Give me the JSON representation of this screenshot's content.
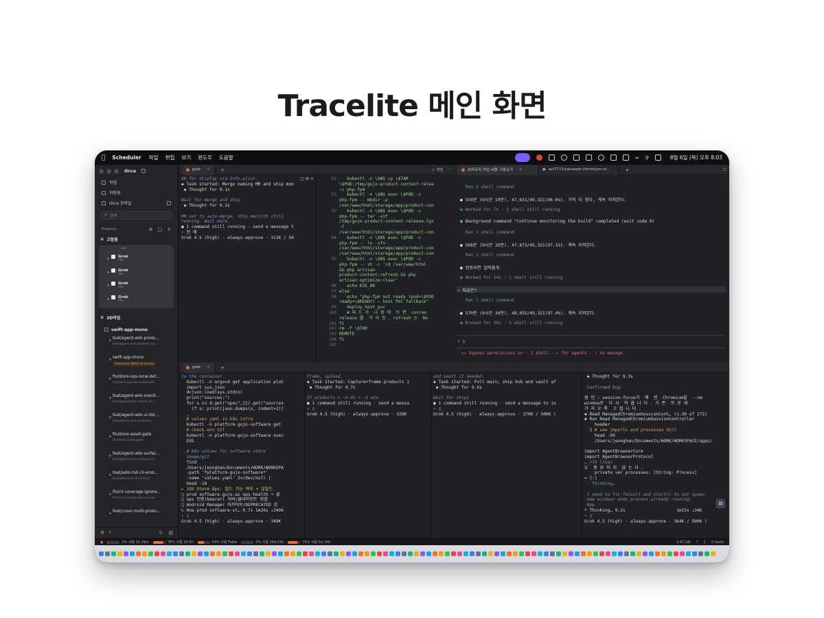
{
  "page_title": "Tracelite 메인 화면",
  "menubar": {
    "app_name": "Scheduler",
    "menus": [
      "파일",
      "편집",
      "보기",
      "윈도우",
      "도움말"
    ],
    "clock": "8월 6일 (목) 오후 8:03"
  },
  "sidebar": {
    "app": "Orca",
    "nav": [
      "작업",
      "자동화",
      "Orca 모바일"
    ],
    "search_placeholder": "검색",
    "projects_label": "Projects",
    "group1": "고정됨",
    "grok_items": [
      {
        "label": "Grok",
        "sub": "Idle"
      },
      {
        "label": "Grok",
        "sub": "Idle"
      },
      {
        "label": "Grok",
        "sub": "Idle"
      },
      {
        "label": "Grok",
        "sub": "Idle"
      }
    ],
    "group2": "3D작업",
    "repo": "swift-app-mono",
    "worktrees": [
      {
        "title": "feat/agent-wiki-produ...",
        "sub": "feat/agent-wiki-product-na..."
      },
      {
        "title": "swift-app-mono",
        "sub": "Detached HEAD @ fcee5b"
      },
      {
        "title": "fix/store-ops-local-def...",
        "sub": "fix/store-ops-local-defaults"
      },
      {
        "title": "feat/agent-wiki-monit...",
        "sub": "feat/agent-wiki-monitr-sh..."
      },
      {
        "title": "feat/agent-wiki-ui-libr...",
        "sub": "feat/agent-wiki-ui-library"
      },
      {
        "title": "fix/store-asset-gate",
        "sub": "fix/store-asset-gate"
      },
      {
        "title": "feat/agent-wiki-surfac...",
        "sub": "feat/agent-wiki-surface-na..."
      },
      {
        "title": "feat/adm-full-cli-emb...",
        "sub": "feat/adm-full-cli-embed"
      },
      {
        "title": "fix/cli-coverage-ignore...",
        "sub": "fix/cli-coverage-ignore-aux"
      },
      {
        "title": "feat/cross-multi-produ...",
        "sub": ""
      }
    ]
  },
  "top_left": {
    "tab": "grok",
    "run_label": "▷ 영령",
    "lines": [
      [
        "c-it",
        "OK for display via Info.plist."
      ],
      [
        "",
        "◆ Task started: Merge naming MR and ship mon"
      ],
      [
        "",
        " ◆ Thought for 0.1s"
      ],
      [
        "",
        ""
      ],
      [
        "c-it",
        "Wait for merge and ship"
      ],
      [
        "",
        " ◆ Thought for 0.2s"
      ],
      [
        "",
        ""
      ],
      [
        "c-it",
        "MR set to auto-merge, ship monlith still"
      ],
      [
        "c-it",
        "running. Wait more."
      ],
      [
        "",
        "● 1 command still running · send a message t"
      ],
      [
        "",
        "› 진 애"
      ],
      [
        "",
        "Grok 4.5 (high) · always-approve · 311K / 50"
      ]
    ],
    "code_lines": [
      [
        "91",
        "   kubectl -n \\$NS cp \\$TAR"
      ],
      [
        "",
        "\\$POD:/tmp/gujo-product-content-relea"
      ],
      [
        "",
        "~c php-fpm"
      ],
      [
        "92",
        "   kubectl -n \\$NS exec \\$POD -c"
      ],
      [
        "",
        "php-fpm -- mkdir -p"
      ],
      [
        "",
        "/var/www/html/storage/app/product-con"
      ],
      [
        "93",
        "   kubectl -n \\$NS exec \\$POD -c"
      ],
      [
        "",
        "php-fpm -- tar -xzf"
      ],
      [
        "",
        "/tmp/gujo-product-content-release.tgz"
      ],
      [
        "",
        "-C"
      ],
      [
        "",
        "/var/www/html/storage/app/product-con"
      ],
      [
        "94",
        "   kubectl -n \\$NS exec \\$POD -c"
      ],
      [
        "",
        "php-fpm -- ln -sfn"
      ],
      [
        "",
        "/var/www/html/storage/app/product-con"
      ],
      [
        "",
        "/var/www/html/storage/app/product-con"
      ],
      [
        "95",
        "   kubectl -n \\$NS exec \\$POD -c"
      ],
      [
        "",
        "php-fpm -- sh -c 'cd /var/www/html"
      ],
      [
        "",
        "&& php artisan"
      ],
      [
        "",
        "product-content:refresh && php"
      ],
      [
        "",
        "artisan optimize:clear'"
      ],
      [
        "96",
        "   echo K3S_OK"
      ],
      [
        "97",
        "else"
      ],
      [
        "98",
        "   echo \"php-fpm not ready (pod=\\$POD"
      ],
      [
        "",
        "ready=\\$READY) — host PVC fallback\""
      ],
      [
        "99",
        "   deploy_host_pvc"
      ],
      [
        "100",
        "   # 파 드 가  나 중 에  뜨 면  curren"
      ],
      [
        "",
        "release 를  가 리 킴 . refresh 는  Re"
      ],
      [
        "101",
        "fi"
      ],
      [
        "102",
        "rm -f \\$TAR"
      ],
      [
        "103",
        "REMOTE"
      ],
      [
        "104",
        "fi"
      ],
      [
        "105",
        ""
      ]
    ]
  },
  "top_right": {
    "tabs": [
      "브라우저 작업 내용 기록오기",
      "avl7771/cacream-chromium-m..."
    ],
    "lines": [
      [
        "dim",
        "Ran 1 shell command"
      ],
      [
        "w",
        "559분 (9시간 19분), 47,631/49,321(96.6%). 거의 다 왔다, 계속 지켜본다."
      ],
      [
        "d",
        "Worked for 7s · 1 shell still running"
      ],
      [
        "g",
        "Background command \"Continue monitoring the build\" completed (exit code 0)"
      ],
      [
        "dim",
        "Ran 1 shell command"
      ],
      [
        "w",
        "566분 (9시간 26분), 47,873/49,321(97.1%). 계속 지켜본다."
      ],
      [
        "dim",
        "Ran 1 shell command"
      ],
      [
        "w",
        "완료되면 알려줄게."
      ],
      [
        "d",
        "Worked for 14s · 1 shell still running"
      ],
      [
        "q",
        "› 지금은?"
      ],
      [
        "dim",
        "Ran 1 shell command"
      ],
      [
        "w",
        "570분 (9시간 30분), 48,055/49,321(97.4%). 계속 지켜본다."
      ],
      [
        "d",
        "Brewed for 10s · 1 shell still running"
      ]
    ],
    "prompt": "› ▯",
    "footer": "▸▸ bypass permissions on · 1 shell · ← for agents · ↓ to manage"
  },
  "bottom": {
    "tab": "grok",
    "col1": [
      [
        "c-it",
        "to the container."
      ],
      [
        "",
        "  kubectl -n argocd get application plat"
      ],
      [
        "",
        "  import sys,json"
      ],
      [
        "",
        "  d=json.load(sys.stdin)"
      ],
      [
        "",
        "  print(\"sources:\")"
      ],
      [
        "",
        "  for s in d.get(\"spec\",{}).get(\"sources"
      ],
      [
        "",
        "    if s: print(json.dumps(s, indent=2)["
      ],
      [
        "",
        "  ,"
      ],
      [
        "c-org",
        "  # values yaml in k8s infra"
      ],
      [
        "",
        "  kubectl -n platform-gujo-software get"
      ],
      [
        "c-org",
        "  # check env GIT"
      ],
      [
        "",
        "  kubectl -n platform-gujo-software exec"
      ],
      [
        "",
        "  EOS"
      ],
      [
        "",
        ""
      ],
      [
        "c-it",
        "  # k8s values for software store"
      ],
      [
        "c-it",
        "  image/git"
      ],
      [
        "",
        "  find"
      ],
      [
        "",
        "  /Users/jeonghan/Documents/WORK/WORKSPA"
      ],
      [
        "",
        "  -path '*platform-gujo-software*'"
      ],
      [
        "",
        "  -name 'values.yaml' 2>/dev/null |"
      ],
      [
        "",
        "  head -10"
      ],
      [
        "c-yel",
        "▸ iOS Store Ops: 빌드 가능 여부 + 실빌드"
      ],
      [
        "",
        "□ prod software.gujo.ai ops health + 클"
      ],
      [
        "",
        "□ ops 인증(bearer) 서버/클라이언트 정합"
      ],
      [
        "",
        "□ Android Manager 아카이브/DEPRECATED 검"
      ],
      [
        "",
        "↳ How prod software-st… 0.7s 1m26s ↓349k"
      ],
      [
        "",
        "› ▯"
      ],
      [
        "",
        "Grok 4.5 (high) · always-approve · 349K"
      ]
    ],
    "col2": [
      [
        "c-it",
        "frame, upload."
      ],
      [
        "",
        "◆ Task started: Capture+frame products 1"
      ],
      [
        "",
        " ◆ Thought for 0.7s"
      ],
      [
        "",
        ""
      ],
      [
        "c-it",
        "37 products × ~3-4s ≈ ~2 min"
      ],
      [
        "",
        "● 1 command still running · send a messa"
      ],
      [
        "",
        "› ▯"
      ],
      [
        "",
        "Grok 4.5 (high) · always-approve · 328K"
      ]
    ],
    "col3": [
      [
        "c-it",
        "and vault if needed."
      ],
      [
        "",
        "◆ Task started: Pull main; ship hub and vault af"
      ],
      [
        "",
        " ◆ Thought for 0.6s"
      ],
      [
        "",
        ""
      ],
      [
        "c-it",
        "Wait for ships"
      ],
      [
        "",
        "● 1 command still running · send a message to in"
      ],
      [
        "",
        "› ▯"
      ],
      [
        "",
        "Grok 4.5 (high) · always-approve · 370K / 500K ("
      ]
    ],
    "col4": [
      [
        "",
        " ◆ Thought for 9.3s"
      ],
      [
        "",
        ""
      ],
      [
        "c-it",
        " Confirmed bug:"
      ],
      [
        "",
        ""
      ],
      [
        "",
        "원 인 : session-focus가  매  번  Chromium을  --ne"
      ],
      [
        "",
        "window로  다 시  띄 웁 니 다 . 기 존  프 로 세"
      ],
      [
        "",
        "가 지 오 록  고 칩 니 다 ."
      ],
      [
        "",
        "◆ Read ManagedChromiumSessionCont… (1-30 of 272)"
      ],
      [
        "",
        "◆ Run Read ManagedChromiumSessionController"
      ],
      [
        "",
        "    header"
      ],
      [
        "c-org",
        "  $ # see imports and processes dict"
      ],
      [
        "",
        "    head -50"
      ],
      [
        "",
        "    /Users/jeonghan/Documents/WORK/WORKSPACE/apps/"
      ],
      [
        "",
        ""
      ],
      [
        "",
        "import AgentBrowserCore"
      ],
      [
        "",
        "import AgentBrowserProtocol"
      ],
      [
        "c-dim",
        "… +70 lines"
      ],
      [
        "",
        "도  종 료 하 지  않 는 다 ."
      ],
      [
        "",
        "    private var processes: [String: Process]"
      ],
      [
        "",
        "= [:]"
      ],
      [
        "c-dim",
        " ◦ Thinking…"
      ],
      [
        "",
        ""
      ],
      [
        "c-it",
        " I need to fix focus() and start() to not spawn"
      ],
      [
        "c-it",
        " new windows when process already running."
      ],
      [
        "c-dim",
        " App"
      ],
      [
        "",
        "* Thinking… 0.2s                    1m15s ↓34k"
      ],
      [
        "",
        "› ▯"
      ],
      [
        "",
        "Grok 4.5 (high) · always-approve · 364K / 500K ("
      ]
    ]
  },
  "statusbar": {
    "items": [
      {
        "text": "3% 사용 1h 29m",
        "fill": 0.03
      },
      {
        "text": "78% 사용 2d 5h",
        "fill": 0.78
      },
      {
        "text": "54% 사용 Fable",
        "fill": 0.54
      },
      {
        "text": "0% 사용 29d 23h",
        "fill": 0.0
      },
      {
        "text": "75% 사용 5d 16h",
        "fill": 0.75
      }
    ],
    "right": [
      "2.67 GB",
      "7",
      "2",
      "0 hosts"
    ]
  },
  "colors": {
    "accent_orange": "#e46b3a",
    "menubar_pill": "#7a5cff"
  }
}
